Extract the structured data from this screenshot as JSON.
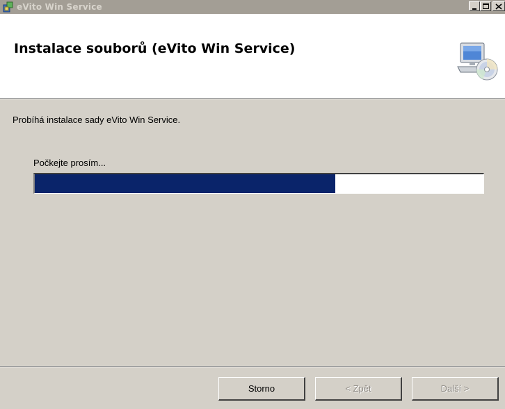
{
  "window": {
    "title": "eVito Win Service",
    "icon": "installer-icon"
  },
  "titlebar_buttons": {
    "minimize": "minimize-icon",
    "maximize": "maximize-icon",
    "close": "close-icon"
  },
  "banner": {
    "title": "Instalace souborů (eVito Win Service)",
    "icon": "computer-cd-icon"
  },
  "body": {
    "status_text": "Probíhá instalace sady eVito Win Service.",
    "progress_label": "Počkejte prosím...",
    "progress_fraction": 0.67,
    "progress_color": "#0a246a"
  },
  "buttons": {
    "cancel_label": "Storno",
    "back_label": "< Zpět",
    "next_label": "Další >",
    "back_enabled": false,
    "next_enabled": false
  }
}
